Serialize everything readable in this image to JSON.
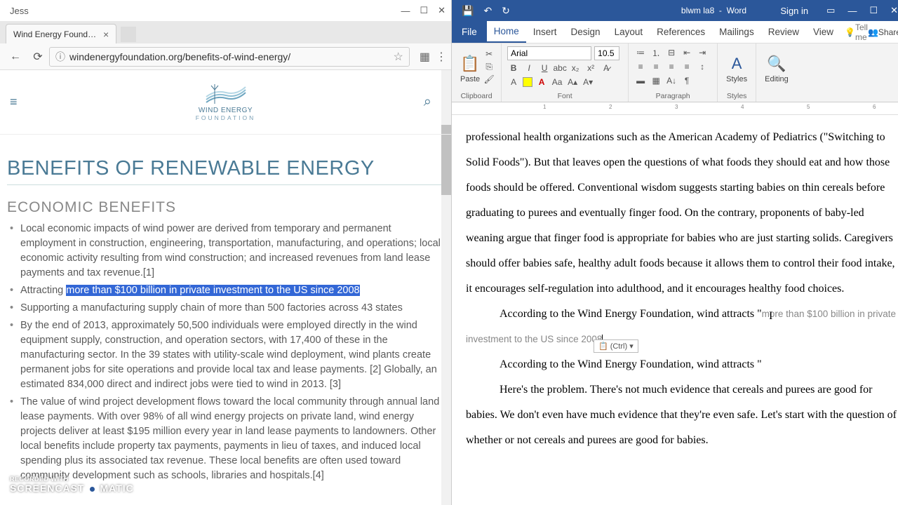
{
  "chrome": {
    "user": "Jess",
    "tab_title": "Wind Energy Foundation",
    "url": "windenergyfoundation.org/benefits-of-wind-energy/"
  },
  "site": {
    "logo_text": "WIND ENERGY",
    "logo_sub": "FOUNDATION",
    "h1": "BENEFITS OF RENEWABLE ENERGY",
    "h2": "ECONOMIC BENEFITS",
    "li1": "Local economic impacts of wind power are derived from temporary and permanent employment in construction, engineering, transportation, manufacturing, and operations; local economic activity resulting from wind construction; and increased revenues from land lease payments and tax revenue.[1]",
    "li2a": "Attracting ",
    "li2b": "more than $100 billion in private investment to the US since 2008",
    "li3": "Supporting a manufacturing supply chain of more than 500 factories across 43 states",
    "li4": "By the end of 2013, approximately 50,500 individuals were employed directly in the wind equipment supply, construction, and operation sectors, with 17,400 of these in the manufacturing sector. In the 39 states with utility-scale wind deployment, wind plants create permanent jobs for site operations and provide local tax and lease payments. [2] Globally, an estimated 834,000 direct and indirect jobs were tied to wind in 2013. [3]",
    "li5": "The value of wind project development flows toward the local community through annual land lease payments. With over 98% of all wind energy projects on private land, wind energy projects deliver at least $195 million every year in land lease payments to landowners. Other local benefits include property tax payments, payments in lieu of taxes, and induced local spending plus its associated tax revenue. These local benefits are often used toward community development such as schools, libraries and hospitals.[4]"
  },
  "word": {
    "doc_name": "blwm la8",
    "app_name": "Word",
    "signin": "Sign in",
    "tabs": [
      "File",
      "Home",
      "Insert",
      "Design",
      "Layout",
      "References",
      "Mailings",
      "Review",
      "View"
    ],
    "tellme": "Tell me",
    "share": "Share",
    "font_name": "Arial",
    "font_size": "10.5",
    "groups": {
      "clipboard": "Clipboard",
      "font": "Font",
      "paragraph": "Paragraph",
      "styles": "Styles",
      "editing": "Editing"
    },
    "paste_label": "Paste",
    "styles_label": "Styles",
    "editing_label": "Editing",
    "ruler_ticks": [
      "1",
      "2",
      "3",
      "4",
      "5",
      "6"
    ],
    "paste_opts": "(Ctrl) ▾",
    "doc": {
      "p1": "professional health organizations such as the American Academy of Pediatrics (\"Switching to Solid Foods\"). But that leaves open the questions of what foods they should eat and how those foods should be offered. Conventional wisdom suggests starting babies on thin cereals before graduating to purees and eventually finger food. On the contrary, proponents of baby-led weaning argue that finger food is appropriate for babies who are just starting solids. Caregivers should offer babies safe, healthy adult foods because it allows them to control their food intake, it encourages self-regulation into adulthood, and it encourages healthy food choices.",
      "p2a": "According to the Wind Energy Foundation, wind attracts \"",
      "p2b": "more than $100 billion in private investment to the US since 2008",
      "p3": "According to the Wind Energy Foundation, wind attracts \"",
      "p4": "Here's the problem. There's not much evidence that cereals and purees are good for babies. We don't even have much evidence that they're even safe. Let's start with the question of whether or not cereals and purees are good for babies."
    }
  },
  "watermark": {
    "rec": "RECORDED WITH",
    "brand_a": "SCREENCAST",
    "brand_b": "MATIC"
  }
}
